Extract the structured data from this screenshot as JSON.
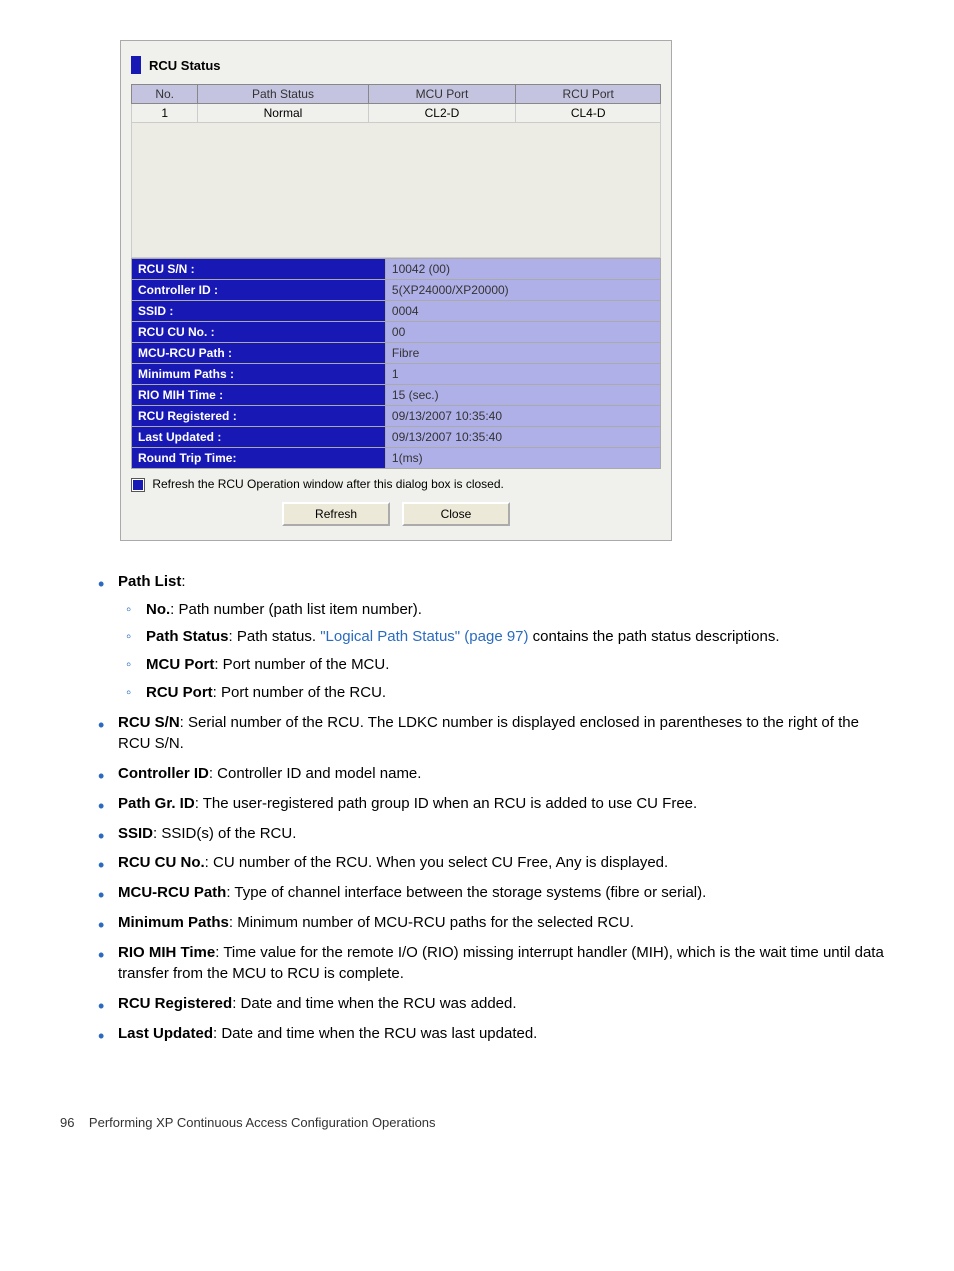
{
  "dialog": {
    "title": "RCU Status",
    "path_headers": [
      "No.",
      "Path Status",
      "MCU Port",
      "RCU Port"
    ],
    "path_rows": [
      {
        "no": "1",
        "status": "Normal",
        "mcu": "CL2-D",
        "rcu": "CL4-D"
      }
    ],
    "kv": [
      {
        "k": "RCU S/N :",
        "v": "10042 (00)"
      },
      {
        "k": "Controller ID :",
        "v": "5(XP24000/XP20000)"
      },
      {
        "k": "SSID :",
        "v": "0004"
      },
      {
        "k": "RCU CU No. :",
        "v": "00"
      },
      {
        "k": "MCU-RCU Path :",
        "v": "Fibre"
      },
      {
        "k": "Minimum Paths :",
        "v": "1"
      },
      {
        "k": "RIO MIH Time :",
        "v": "15 (sec.)"
      },
      {
        "k": "RCU Registered :",
        "v": "09/13/2007 10:35:40"
      },
      {
        "k": "Last Updated :",
        "v": "09/13/2007 10:35:40"
      },
      {
        "k": "Round Trip Time:",
        "v": "1(ms)"
      }
    ],
    "refresh_label": "Refresh the RCU Operation window after this dialog box is closed.",
    "refresh_btn": "Refresh",
    "close_btn": "Close"
  },
  "doc": {
    "path_list": {
      "title": "Path List",
      "items": {
        "no": {
          "term": "No.",
          "desc": ": Path number (path list item number)."
        },
        "path_status": {
          "term": "Path Status",
          "desc_a": ": Path status. ",
          "link": "\"Logical Path Status\" (page 97)",
          "desc_b": " contains the path status descriptions."
        },
        "mcu_port": {
          "term": "MCU Port",
          "desc": ": Port number of the MCU."
        },
        "rcu_port": {
          "term": "RCU Port",
          "desc": ": Port number of the RCU."
        }
      }
    },
    "bullets": {
      "rcu_sn": {
        "term": "RCU S/N",
        "desc": ": Serial number of the RCU. The LDKC number is displayed enclosed in parentheses to the right of the RCU S/N."
      },
      "controller_id": {
        "term": "Controller ID",
        "desc": ": Controller ID and model name."
      },
      "path_gr_id": {
        "term": "Path Gr. ID",
        "desc": ": The user-registered path group ID when an RCU is added to use CU Free."
      },
      "ssid": {
        "term": "SSID",
        "desc": ": SSID(s) of the RCU."
      },
      "rcu_cu_no": {
        "term": "RCU CU No.",
        "desc": ": CU number of the RCU. When you select CU Free, Any is displayed."
      },
      "mcu_rcu_path": {
        "term": "MCU-RCU Path",
        "desc": ": Type of channel interface between the storage systems (fibre or serial)."
      },
      "min_paths": {
        "term": "Minimum Paths",
        "desc": ": Minimum number of MCU-RCU paths for the selected RCU."
      },
      "rio_mih": {
        "term": "RIO MIH Time",
        "desc": ": Time value for the remote I/O (RIO) missing interrupt handler (MIH), which is the wait time until data transfer from the MCU to RCU is complete."
      },
      "rcu_registered": {
        "term": "RCU Registered",
        "desc": ": Date and time when the RCU was added."
      },
      "last_updated": {
        "term": "Last Updated",
        "desc": ": Date and time when the RCU was last updated."
      }
    }
  },
  "footer": {
    "page": "96",
    "chapter": "Performing XP Continuous Access Configuration Operations"
  }
}
